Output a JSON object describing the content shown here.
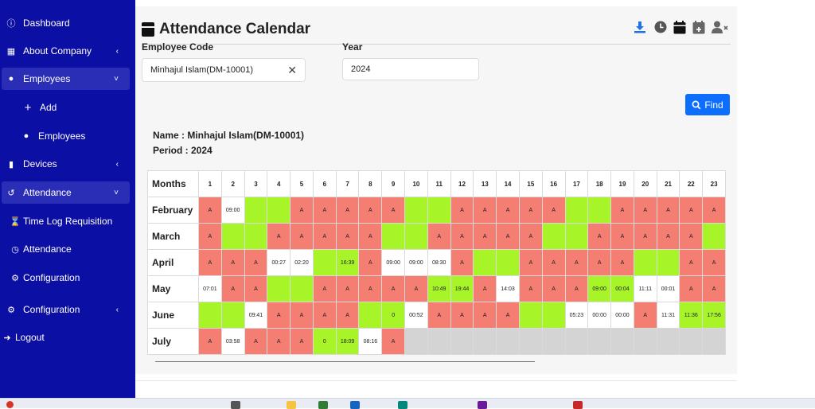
{
  "sidebar": {
    "items": [
      {
        "label": "Dashboard",
        "icon": "info-icon"
      },
      {
        "label": "About Company",
        "icon": "building-icon"
      },
      {
        "label": "Employees",
        "icon": "users-icon"
      },
      {
        "label": "Add",
        "icon": "plus-icon"
      },
      {
        "label": "Employees",
        "icon": "users-icon"
      },
      {
        "label": "Devices",
        "icon": "device-icon"
      },
      {
        "label": "Attendance",
        "icon": "history-icon"
      },
      {
        "label": "Time Log Requisition",
        "icon": "hourglass-icon"
      },
      {
        "label": "Attendance",
        "icon": "clock-icon"
      },
      {
        "label": "Configuration",
        "icon": "gear-icon"
      },
      {
        "label": "Configuration",
        "icon": "gear-icon"
      },
      {
        "label": "Logout",
        "icon": "logout-icon"
      }
    ]
  },
  "header": {
    "title": "Attendance Calendar"
  },
  "form": {
    "employee_label": "Employee Code",
    "employee_value": "Minhajul Islam(DM-10001)",
    "year_label": "Year",
    "year_value": "2024",
    "find_label": "Find"
  },
  "info": {
    "name": "Name : Minhajul Islam(DM-10001)",
    "period": "Period : 2024"
  },
  "colors": {
    "absent": "#f47e72",
    "present": "#a7f529",
    "accent": "#0d6efd",
    "sidebar": "#0c0fa3"
  },
  "calendar": {
    "header": "Months",
    "days": [
      "1",
      "2",
      "3",
      "4",
      "5",
      "6",
      "7",
      "8",
      "9",
      "10",
      "11",
      "12",
      "13",
      "14",
      "15",
      "16",
      "17",
      "18",
      "19",
      "20",
      "21",
      "22",
      "23"
    ],
    "rows": [
      {
        "month": "February",
        "cells": [
          [
            "A",
            "A"
          ],
          [
            "09:00",
            "W"
          ],
          [
            "",
            "P"
          ],
          [
            "",
            "P"
          ],
          [
            "A",
            "A"
          ],
          [
            "A",
            "A"
          ],
          [
            "A",
            "A"
          ],
          [
            "A",
            "A"
          ],
          [
            "A",
            "A"
          ],
          [
            "",
            "P"
          ],
          [
            "",
            "P"
          ],
          [
            "A",
            "A"
          ],
          [
            "A",
            "A"
          ],
          [
            "A",
            "A"
          ],
          [
            "A",
            "A"
          ],
          [
            "A",
            "A"
          ],
          [
            "",
            "P"
          ],
          [
            "",
            "P"
          ],
          [
            "A",
            "A"
          ],
          [
            "A",
            "A"
          ],
          [
            "A",
            "A"
          ],
          [
            "A",
            "A"
          ],
          [
            "A",
            "A"
          ]
        ]
      },
      {
        "month": "March",
        "cells": [
          [
            "A",
            "A"
          ],
          [
            "",
            "P"
          ],
          [
            "",
            "P"
          ],
          [
            "A",
            "A"
          ],
          [
            "A",
            "A"
          ],
          [
            "A",
            "A"
          ],
          [
            "A",
            "A"
          ],
          [
            "A",
            "A"
          ],
          [
            "",
            "P"
          ],
          [
            "",
            "P"
          ],
          [
            "A",
            "A"
          ],
          [
            "A",
            "A"
          ],
          [
            "A",
            "A"
          ],
          [
            "A",
            "A"
          ],
          [
            "A",
            "A"
          ],
          [
            "",
            "P"
          ],
          [
            "",
            "P"
          ],
          [
            "A",
            "A"
          ],
          [
            "A",
            "A"
          ],
          [
            "A",
            "A"
          ],
          [
            "A",
            "A"
          ],
          [
            "A",
            "A"
          ],
          [
            "",
            "P"
          ]
        ]
      },
      {
        "month": "April",
        "cells": [
          [
            "A",
            "A"
          ],
          [
            "A",
            "A"
          ],
          [
            "A",
            "A"
          ],
          [
            "00:27",
            "W"
          ],
          [
            "02:20",
            "W"
          ],
          [
            "",
            "P"
          ],
          [
            "16:39",
            "P"
          ],
          [
            "A",
            "A"
          ],
          [
            "09:00",
            "W"
          ],
          [
            "09:00",
            "W"
          ],
          [
            "08:30",
            "W"
          ],
          [
            "A",
            "A"
          ],
          [
            "",
            "P"
          ],
          [
            "",
            "P"
          ],
          [
            "A",
            "A"
          ],
          [
            "A",
            "A"
          ],
          [
            "A",
            "A"
          ],
          [
            "A",
            "A"
          ],
          [
            "A",
            "A"
          ],
          [
            "",
            "P"
          ],
          [
            "",
            "P"
          ],
          [
            "A",
            "A"
          ],
          [
            "A",
            "A"
          ]
        ]
      },
      {
        "month": "May",
        "cells": [
          [
            "07:01",
            "W"
          ],
          [
            "A",
            "A"
          ],
          [
            "A",
            "A"
          ],
          [
            "",
            "P"
          ],
          [
            "",
            "P"
          ],
          [
            "A",
            "A"
          ],
          [
            "A",
            "A"
          ],
          [
            "A",
            "A"
          ],
          [
            "A",
            "A"
          ],
          [
            "A",
            "A"
          ],
          [
            "10:49",
            "P"
          ],
          [
            "19:44",
            "P"
          ],
          [
            "A",
            "A"
          ],
          [
            "14:03",
            "W"
          ],
          [
            "A",
            "A"
          ],
          [
            "A",
            "A"
          ],
          [
            "A",
            "A"
          ],
          [
            "09:00",
            "P"
          ],
          [
            "00:04",
            "P"
          ],
          [
            "11:11",
            "W"
          ],
          [
            "00:01",
            "W"
          ],
          [
            "A",
            "A"
          ],
          [
            "A",
            "A"
          ]
        ]
      },
      {
        "month": "June",
        "cells": [
          [
            "",
            "P"
          ],
          [
            "",
            "P"
          ],
          [
            "09:41",
            "W"
          ],
          [
            "A",
            "A"
          ],
          [
            "A",
            "A"
          ],
          [
            "A",
            "A"
          ],
          [
            "A",
            "A"
          ],
          [
            "",
            "P"
          ],
          [
            "0",
            "P"
          ],
          [
            "00:52",
            "W"
          ],
          [
            "A",
            "A"
          ],
          [
            "A",
            "A"
          ],
          [
            "A",
            "A"
          ],
          [
            "A",
            "A"
          ],
          [
            "",
            "P"
          ],
          [
            "",
            "P"
          ],
          [
            "05:23",
            "W"
          ],
          [
            "00:00",
            "W"
          ],
          [
            "00:00",
            "W"
          ],
          [
            "A",
            "A"
          ],
          [
            "11:31",
            "W"
          ],
          [
            "11:36",
            "P"
          ],
          [
            "17:56",
            "P"
          ]
        ]
      },
      {
        "month": "July",
        "cells": [
          [
            "A",
            "A"
          ],
          [
            "03:58",
            "W"
          ],
          [
            "A",
            "A"
          ],
          [
            "A",
            "A"
          ],
          [
            "A",
            "A"
          ],
          [
            "0",
            "P"
          ],
          [
            "18:09",
            "P"
          ],
          [
            "08:16",
            "W"
          ],
          [
            "A",
            "A"
          ],
          [
            "",
            "E"
          ],
          [
            "",
            "E"
          ],
          [
            "",
            "E"
          ],
          [
            "",
            "E"
          ],
          [
            "",
            "E"
          ],
          [
            "",
            "E"
          ],
          [
            "",
            "E"
          ],
          [
            "",
            "E"
          ],
          [
            "",
            "E"
          ],
          [
            "",
            "E"
          ],
          [
            "",
            "E"
          ],
          [
            "",
            "E"
          ],
          [
            "",
            "E"
          ],
          [
            "",
            "E"
          ]
        ]
      }
    ]
  }
}
